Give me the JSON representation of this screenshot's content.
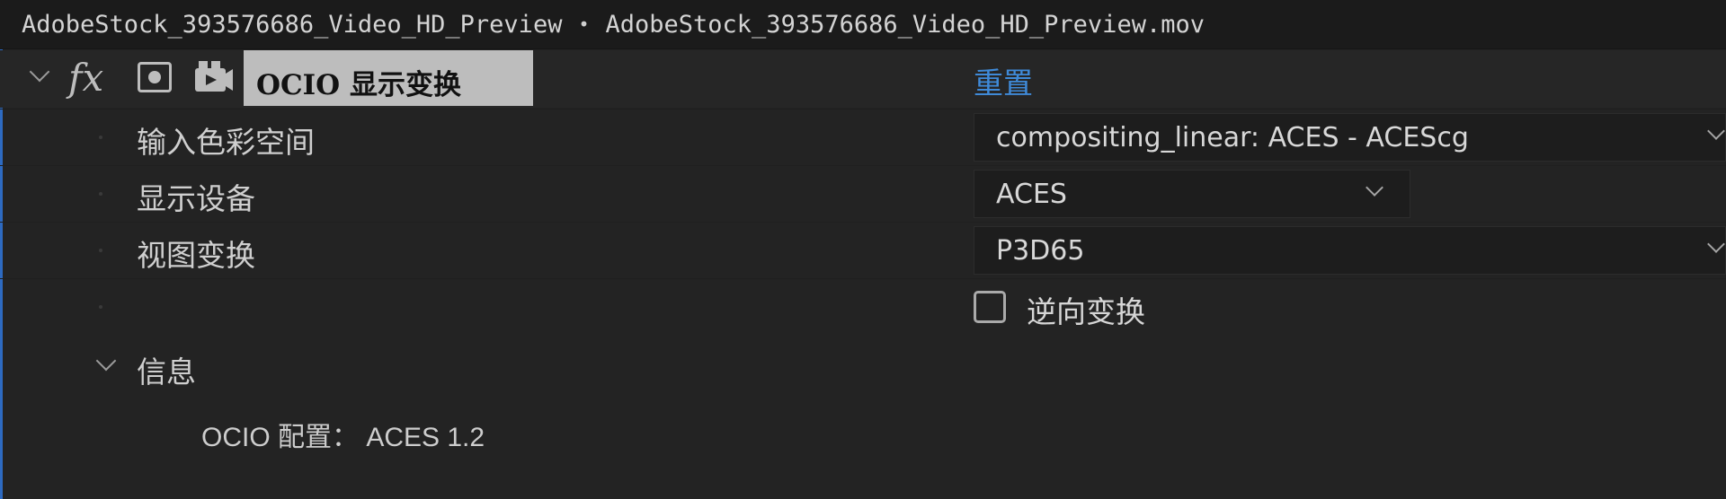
{
  "titlebar": {
    "composition": "AdobeStock_393576686_Video_HD_Preview",
    "separator": "•",
    "layer": "AdobeStock_393576686_Video_HD_Preview.mov"
  },
  "effect": {
    "fx_symbol": "fx",
    "name": "OCIO 显示变换",
    "reset_label": "重置"
  },
  "properties": [
    {
      "label": "输入色彩空间",
      "value": "compositing_linear: ACES - ACEScg"
    },
    {
      "label": "显示设备",
      "value": "ACES"
    },
    {
      "label": "视图变换",
      "value": "P3D65"
    }
  ],
  "invert": {
    "label": "逆向变换",
    "checked": false
  },
  "info": {
    "label": "信息",
    "config": "OCIO 配置： ACES 1.2"
  },
  "colors": {
    "background": "#232323",
    "accent": "#3f8ad8",
    "effect_name_bg": "#bdbdbd"
  }
}
